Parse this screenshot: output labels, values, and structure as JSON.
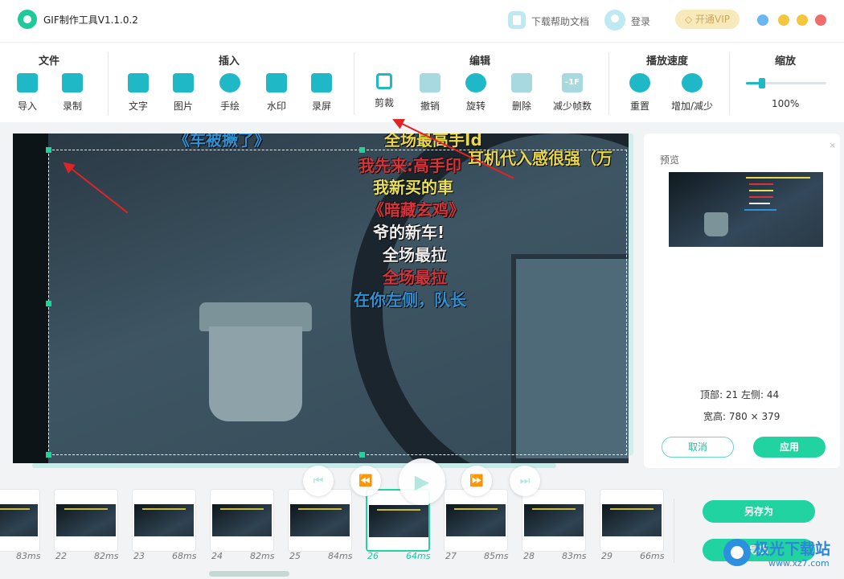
{
  "titlebar": {
    "app_title": "GIF制作工具V1.1.0.2",
    "help_doc": "下载帮助文档",
    "login": "登录",
    "vip": "开通VIP"
  },
  "toolbar": {
    "groups": {
      "file": "文件",
      "insert": "插入",
      "edit": "编辑",
      "speed": "播放速度",
      "zoom": "缩放"
    },
    "tools": {
      "import": "导入",
      "record": "录制",
      "text": "文字",
      "image": "图片",
      "draw": "手绘",
      "watermark": "水印",
      "screen_record": "录屏",
      "crop": "剪裁",
      "undo": "撤销",
      "rotate": "旋转",
      "delete": "删除",
      "reduce_frames": "减少帧数",
      "reset": "重置",
      "inc_dec": "增加/减少"
    },
    "reduce_frames_icon_text": "-1F",
    "zoom_value": "100%",
    "zoom_level": 0.2
  },
  "canvas": {
    "danmu": [
      "《车被撅了》",
      "全场最高手Id",
      "我先来:高手印",
      "耳机代入感很强（万",
      "我新买的車",
      "《暗藏玄鸡》",
      "爷的新车!",
      "全场最拉",
      "全场最拉",
      "在你左侧，队长"
    ]
  },
  "preview": {
    "title": "预览",
    "close": "×",
    "top_label": "顶部:",
    "top_value": "21",
    "left_label": "左侧:",
    "left_value": "44",
    "size_label": "宽高:",
    "size_value": "780 × 379",
    "cancel": "取消",
    "apply": "应用"
  },
  "frames": [
    {
      "num": "",
      "ms": "83ms"
    },
    {
      "num": "22",
      "ms": "82ms"
    },
    {
      "num": "23",
      "ms": "68ms"
    },
    {
      "num": "24",
      "ms": "82ms"
    },
    {
      "num": "25",
      "ms": "84ms"
    },
    {
      "num": "26",
      "ms": "64ms"
    },
    {
      "num": "27",
      "ms": "85ms"
    },
    {
      "num": "28",
      "ms": "83ms"
    },
    {
      "num": "29",
      "ms": "66ms"
    }
  ],
  "actions": {
    "save_as": "另存为",
    "export": "导出"
  },
  "site_watermark": {
    "name": "极光下载站",
    "url": "www.xz7.com"
  },
  "colors": {
    "accent": "#22d3a2",
    "tool_icon": "#1fb8c7",
    "arrow": "#e02424"
  }
}
